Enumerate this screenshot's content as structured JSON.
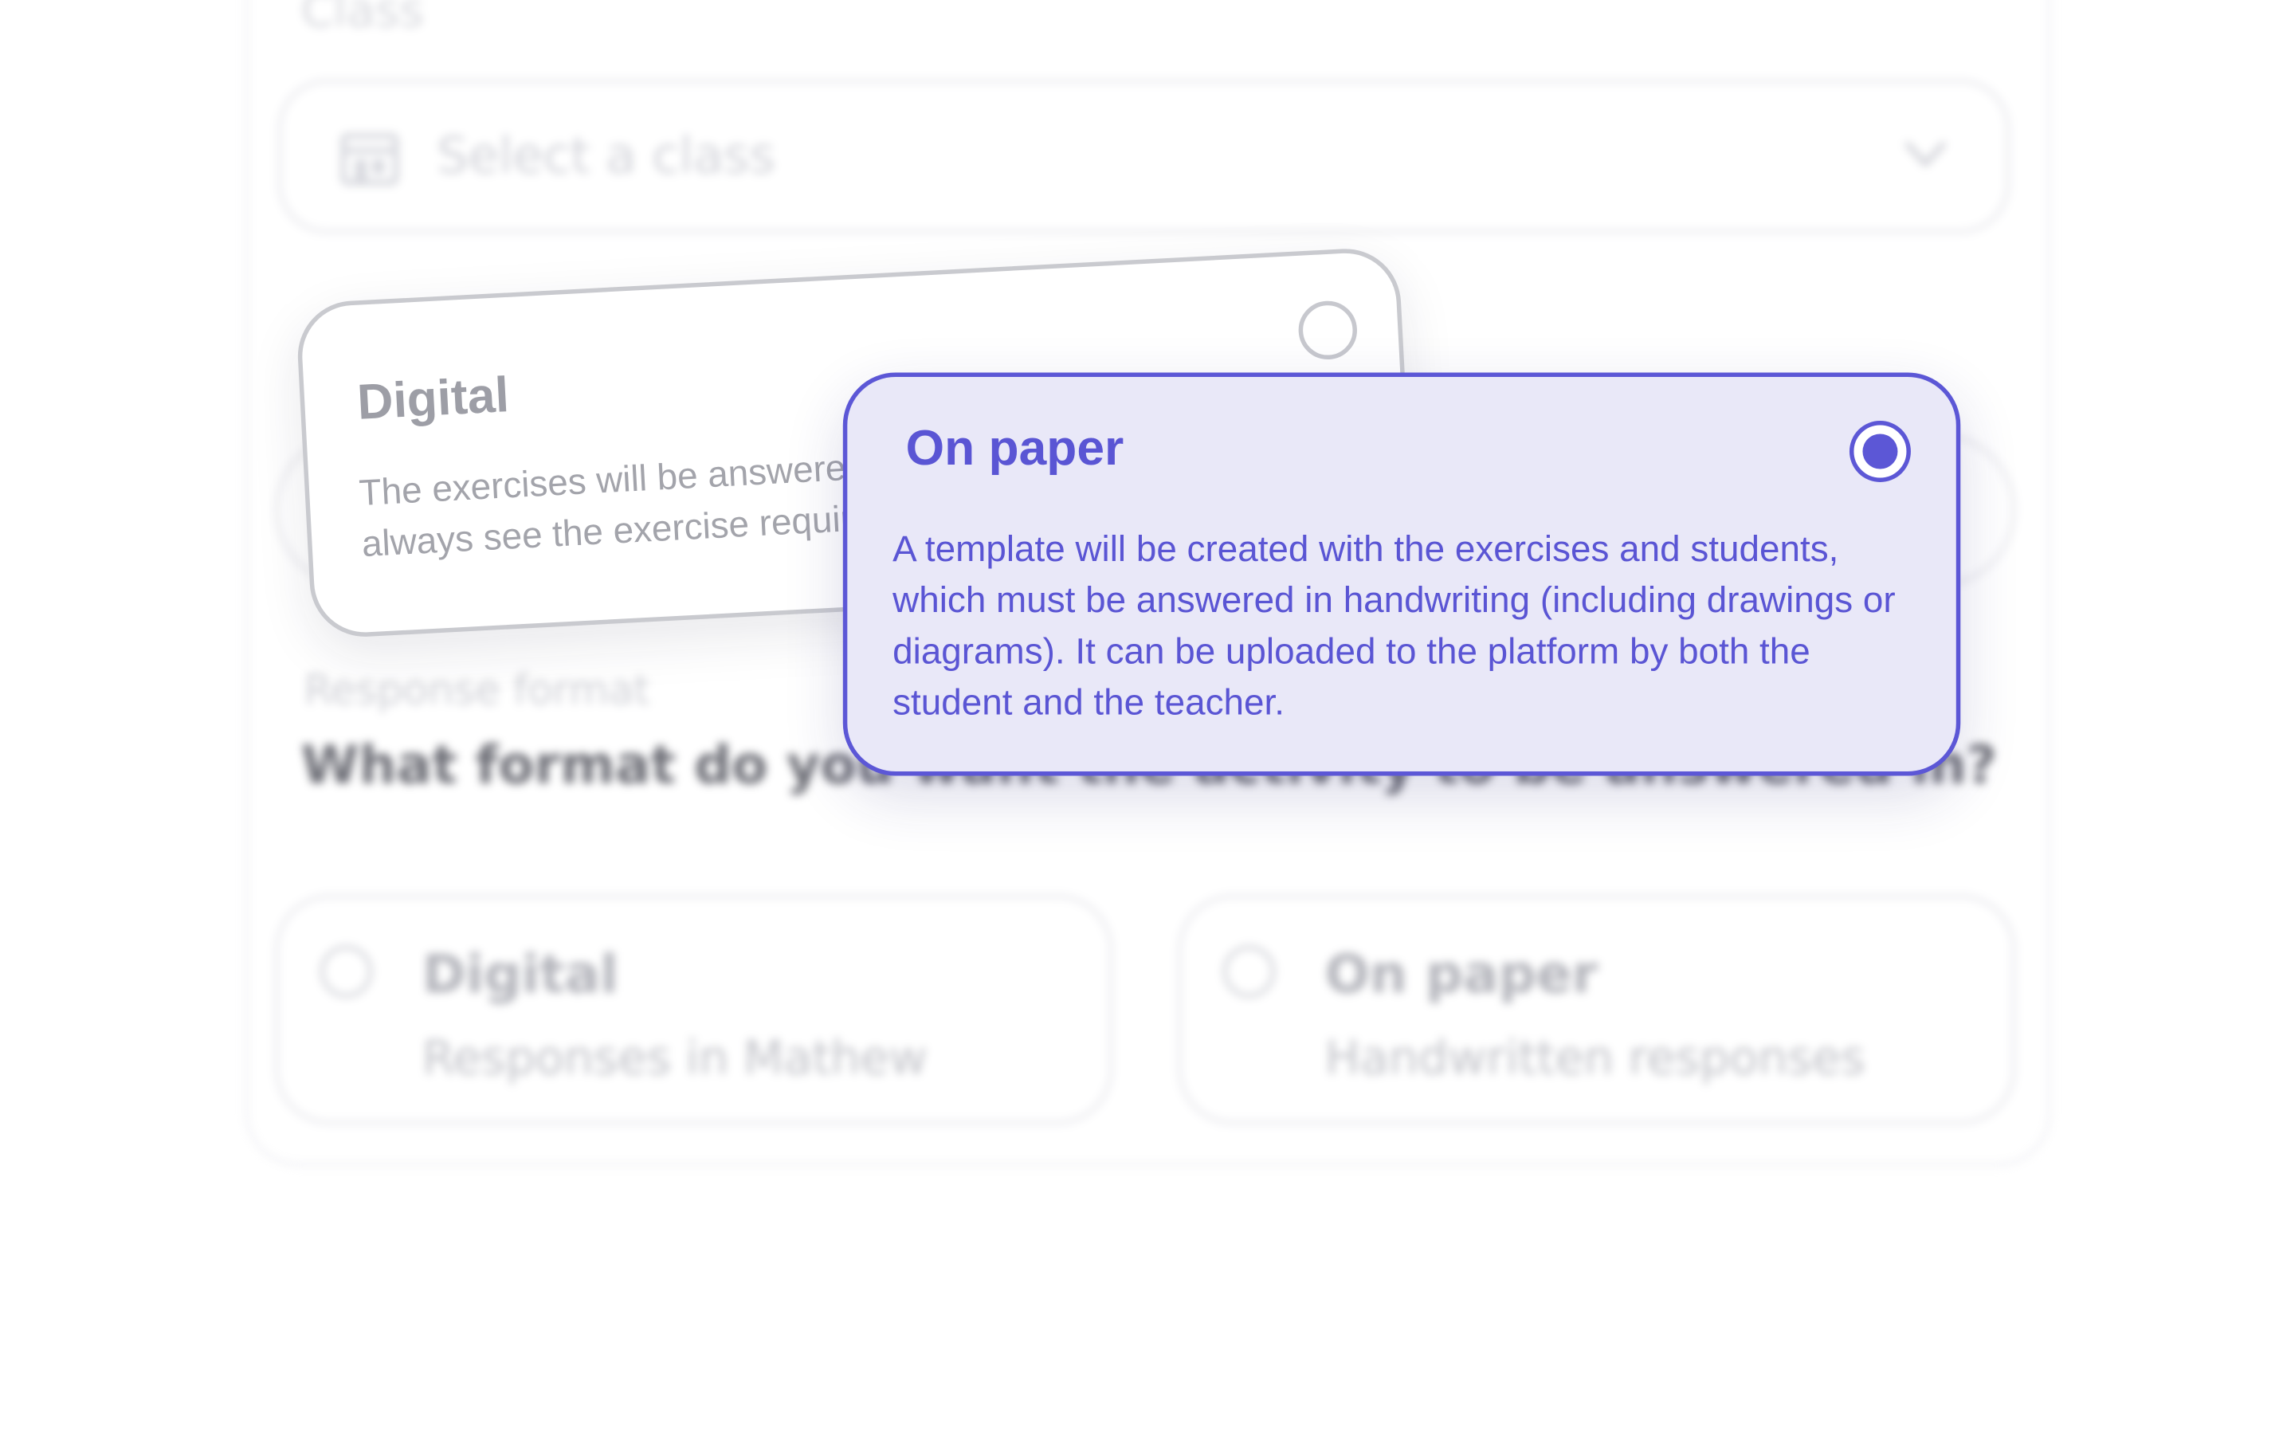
{
  "form": {
    "class_label": "Class",
    "class_select_placeholder": "Select a class",
    "response_format_label": "Response format",
    "response_format_question": "What format do you want the activity to be answered in?",
    "options": [
      {
        "title": "Digital",
        "subtitle": "Responses in Mathew",
        "selected": false
      },
      {
        "title": "On paper",
        "subtitle": "Handwritten responses",
        "selected": false
      }
    ]
  },
  "digital_card": {
    "title": "Digital",
    "description": "The exercises will be answered in Mathew. The student will always see the exercise requires it.",
    "selected": false
  },
  "paper_card": {
    "title": "On paper",
    "description": "A template will be created with the exercises and students, which must be answered in handwriting (including drawings or diagrams). It can be uploaded to the platform by both the student and the teacher.",
    "selected": true
  },
  "colors": {
    "accent": "#5c57d6",
    "selected_bg": "#e9e8f8",
    "muted_text": "#a3a4ab"
  },
  "icons": {
    "class_select": "school-icon",
    "dropdown": "chevron-down-icon"
  }
}
